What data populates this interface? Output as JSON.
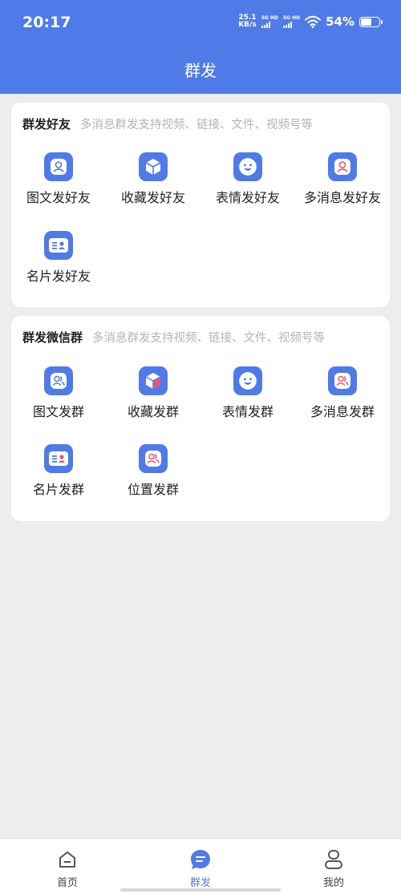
{
  "status": {
    "time": "20:17",
    "speed_value": "25.1",
    "speed_unit": "KB/s",
    "net1": "5G HD",
    "net2": "5G HD",
    "battery_pct": "54%",
    "battery_level": 0.54,
    "wifi_icon": "wifi-icon"
  },
  "header": {
    "title": "群发"
  },
  "friends_section": {
    "title": "群发好友",
    "subtitle": "多消息群发支持视频、链接、文件、视频号等",
    "items": [
      {
        "label": "图文发好友",
        "icon": "portrait-icon"
      },
      {
        "label": "收藏发好友",
        "icon": "box-icon"
      },
      {
        "label": "表情发好友",
        "icon": "smiley-icon"
      },
      {
        "label": "多消息发好友",
        "icon": "person-red-icon"
      },
      {
        "label": "名片发好友",
        "icon": "contact-card-icon"
      }
    ]
  },
  "groups_section": {
    "title": "群发微信群",
    "subtitle": "多消息群发支持视频、链接、文件、视频号等",
    "items": [
      {
        "label": "图文发群",
        "icon": "group-icon"
      },
      {
        "label": "收藏发群",
        "icon": "box-icon"
      },
      {
        "label": "表情发群",
        "icon": "smiley-icon"
      },
      {
        "label": "多消息发群",
        "icon": "group-red-icon"
      },
      {
        "label": "名片发群",
        "icon": "contact-card-icon"
      },
      {
        "label": "位置发群",
        "icon": "group-location-icon"
      }
    ]
  },
  "bottom_nav": {
    "items": [
      {
        "label": "首页",
        "icon": "home-icon",
        "active": false
      },
      {
        "label": "群发",
        "icon": "chat-icon",
        "active": true
      },
      {
        "label": "我的",
        "icon": "user-icon",
        "active": false
      }
    ]
  },
  "colors": {
    "primary": "#4f7be9",
    "accent_red": "#e9566b",
    "background": "#ededed"
  }
}
